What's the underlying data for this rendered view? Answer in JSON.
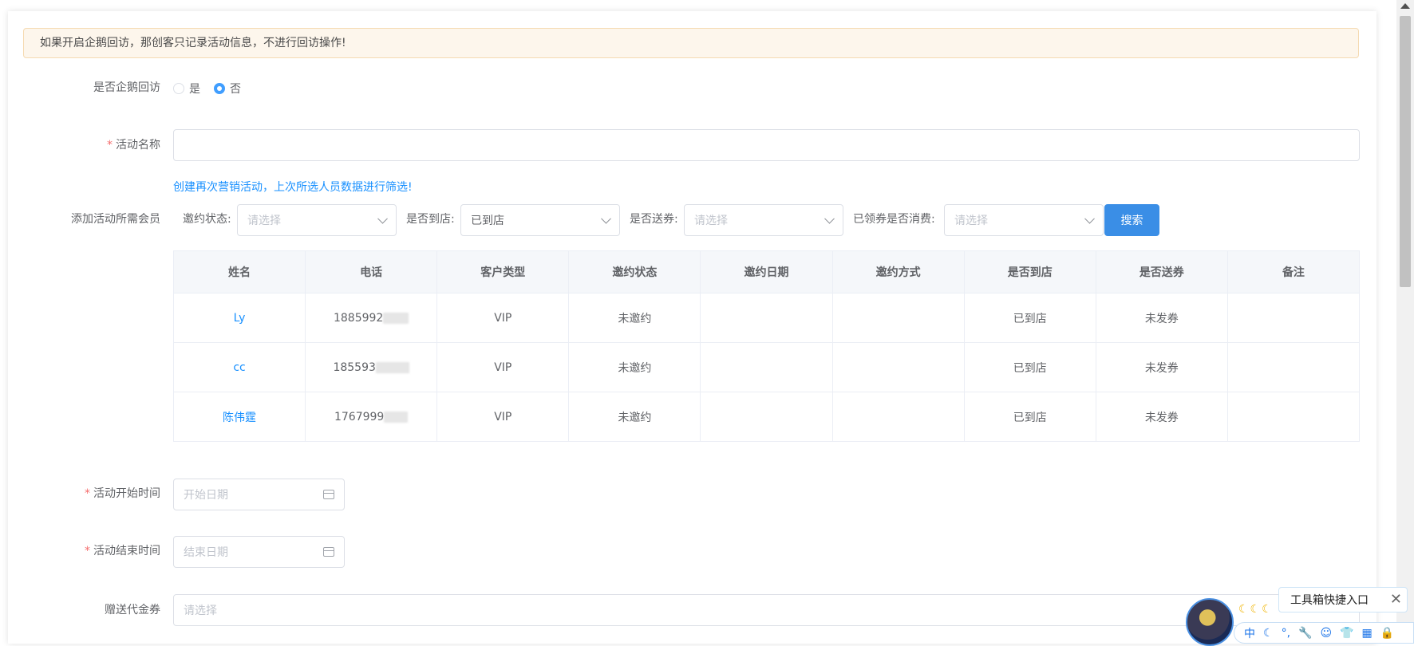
{
  "alert": {
    "text": "如果开启企鹅回访，那创客只记录活动信息，不进行回访操作!"
  },
  "visit": {
    "label": "是否企鹅回访",
    "options": [
      "是",
      "否"
    ],
    "selected": "否"
  },
  "activity_name": {
    "label": "活动名称",
    "value": ""
  },
  "hint": "创建再次营销活动，上次所选人员数据进行筛选!",
  "members": {
    "label": "添加活动所需会员"
  },
  "filters": {
    "invite_status": {
      "label": "邀约状态:",
      "placeholder": "请选择"
    },
    "arrived": {
      "label": "是否到店:",
      "value": "已到店"
    },
    "coupon_sent": {
      "label": "是否送券:",
      "placeholder": "请选择"
    },
    "coupon_used": {
      "label": "已领券是否消费:",
      "placeholder": "请选择"
    },
    "search_label": "搜索"
  },
  "table": {
    "headers": [
      "姓名",
      "电话",
      "客户类型",
      "邀约状态",
      "邀约日期",
      "邀约方式",
      "是否到店",
      "是否送券",
      "备注"
    ],
    "rows": [
      {
        "name": "Ly",
        "phone": "1885992",
        "type": "VIP",
        "invite": "未邀约",
        "date": "",
        "method": "",
        "arrived": "已到店",
        "coupon": "未发券",
        "note": ""
      },
      {
        "name": "cc",
        "phone": "185593",
        "type": "VIP",
        "invite": "未邀约",
        "date": "",
        "method": "",
        "arrived": "已到店",
        "coupon": "未发券",
        "note": ""
      },
      {
        "name": "陈伟霆",
        "phone": "1767999",
        "type": "VIP",
        "invite": "未邀约",
        "date": "",
        "method": "",
        "arrived": "已到店",
        "coupon": "未发券",
        "note": ""
      }
    ]
  },
  "start_time": {
    "label": "活动开始时间",
    "placeholder": "开始日期"
  },
  "end_time": {
    "label": "活动结束时间",
    "placeholder": "结束日期"
  },
  "voucher": {
    "label": "赠送代金券",
    "placeholder": "请选择"
  },
  "toolbox": {
    "text": "工具箱快捷入口",
    "close": "✕"
  },
  "ime": {
    "lang": "中"
  }
}
